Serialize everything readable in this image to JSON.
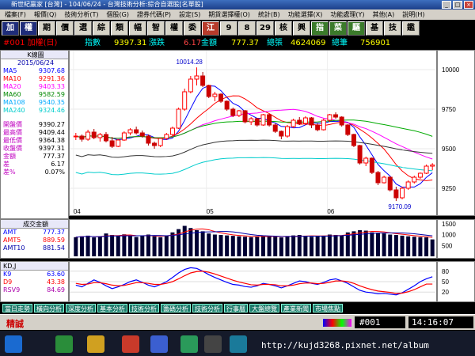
{
  "window": {
    "title": "新世紀贏家 [台灣] - 104/06/24 - 台灣技術分析:綜合自選股[名單股]",
    "controls": [
      "_",
      "□",
      "×"
    ]
  },
  "menu": [
    "檔案(F)",
    "報價(Q)",
    "技術分析(T)",
    "個股(G)",
    "證券代碼(P)",
    "設定(S)",
    "期貨選擇權(O)",
    "統計(B)",
    "功能選擇(X)",
    "功能處理(Y)",
    "其他(A)",
    "說明(H)"
  ],
  "toolbar": [
    "加",
    "權",
    "期",
    "價",
    "選",
    "綜",
    "類",
    "幅",
    "智",
    "權",
    "委",
    "江",
    "9",
    "8",
    "29",
    "核",
    "興",
    "指",
    "菜",
    "驅",
    "基",
    "技",
    "鑑"
  ],
  "infobar": {
    "code": "#001 加權(日)",
    "price_label": "指數",
    "price": "9397.31",
    "change_label": "漲跌",
    "change": "6.17",
    "amount_label": "金額",
    "amount": "777.37",
    "volume_label": "總張",
    "volume": "4624069",
    "lots_label": "總筆",
    "lots": "756901"
  },
  "left_panel": {
    "kline_header": "K線圖",
    "date": "2015/06/24",
    "rows": [
      {
        "label": "MA5",
        "value": "9307.68",
        "color": "#0000ff"
      },
      {
        "label": "MA10",
        "value": "9291.36",
        "color": "#ff0000"
      },
      {
        "label": "MA20",
        "value": "9403.33",
        "color": "#ff00ff"
      },
      {
        "label": "MA60",
        "value": "9582.59",
        "color": "#008800"
      },
      {
        "label": "MA108",
        "value": "9540.35",
        "color": "#00aaff"
      },
      {
        "label": "MA240",
        "value": "9324.46",
        "color": "#00cccc"
      }
    ],
    "ohlc": [
      {
        "label": "開盤價",
        "value": "9390.27"
      },
      {
        "label": "最高價",
        "value": "9409.44"
      },
      {
        "label": "最低價",
        "value": "9364.38"
      },
      {
        "label": "收盤價",
        "value": "9397.31"
      },
      {
        "label": "金額",
        "value": "777.37"
      },
      {
        "label": "差",
        "value": "6.17"
      },
      {
        "label": "差%",
        "value": "0.07%"
      }
    ],
    "vol_header": "成交金額",
    "vol_rows": [
      {
        "label": "AMT",
        "value": "777.37",
        "color": "#0000ff"
      },
      {
        "label": "AMT5",
        "value": "889.59",
        "color": "#ff0000"
      },
      {
        "label": "AMT10",
        "value": "881.54",
        "color": "#0000aa"
      }
    ],
    "kd_header": "KD,J",
    "kd_rows": [
      {
        "label": "K9",
        "value": "63.60",
        "color": "#0000ff"
      },
      {
        "label": "D9",
        "value": "43.38",
        "color": "#ff0000"
      },
      {
        "label": "RSV9",
        "value": "84.69",
        "color": "#aa00aa"
      }
    ]
  },
  "chart_data": [
    {
      "type": "candlestick",
      "x_tick_labels": [
        "04",
        "05",
        "06"
      ],
      "y_ticks": [
        "10000",
        "9750",
        "9500",
        "9250"
      ],
      "ylim": [
        9100,
        10100
      ],
      "annotations": [
        "10014.28",
        "9170.09"
      ],
      "candles": [
        [
          9575,
          9600,
          9555,
          9580
        ],
        [
          9580,
          9590,
          9545,
          9560
        ],
        [
          9560,
          9620,
          9550,
          9605
        ],
        [
          9605,
          9625,
          9560,
          9570
        ],
        [
          9570,
          9600,
          9545,
          9590
        ],
        [
          9590,
          9605,
          9540,
          9550
        ],
        [
          9550,
          9575,
          9505,
          9515
        ],
        [
          9515,
          9560,
          9510,
          9555
        ],
        [
          9555,
          9610,
          9550,
          9600
        ],
        [
          9600,
          9630,
          9585,
          9620
        ],
        [
          9620,
          9640,
          9590,
          9600
        ],
        [
          9600,
          9615,
          9570,
          9580
        ],
        [
          9580,
          9590,
          9520,
          9535
        ],
        [
          9535,
          9545,
          9500,
          9520
        ],
        [
          9520,
          9570,
          9510,
          9565
        ],
        [
          9565,
          9600,
          9555,
          9590
        ],
        [
          9590,
          9640,
          9580,
          9630
        ],
        [
          9630,
          9760,
          9625,
          9750
        ],
        [
          9750,
          9880,
          9740,
          9860
        ],
        [
          9860,
          9960,
          9850,
          9940
        ],
        [
          9940,
          10014,
          9900,
          9960
        ],
        [
          9960,
          9985,
          9890,
          9900
        ],
        [
          9900,
          9905,
          9820,
          9830
        ],
        [
          9830,
          9860,
          9800,
          9845
        ],
        [
          9845,
          9850,
          9790,
          9800
        ],
        [
          9800,
          9805,
          9740,
          9750
        ],
        [
          9750,
          9760,
          9700,
          9710
        ],
        [
          9710,
          9745,
          9700,
          9740
        ],
        [
          9740,
          9745,
          9660,
          9670
        ],
        [
          9670,
          9700,
          9650,
          9690
        ],
        [
          9690,
          9695,
          9640,
          9650
        ],
        [
          9650,
          9720,
          9645,
          9715
        ],
        [
          9715,
          9720,
          9640,
          9650
        ],
        [
          9650,
          9660,
          9600,
          9610
        ],
        [
          9610,
          9615,
          9560,
          9580
        ],
        [
          9580,
          9650,
          9570,
          9640
        ],
        [
          9640,
          9690,
          9630,
          9680
        ],
        [
          9680,
          9700,
          9650,
          9660
        ],
        [
          9660,
          9705,
          9650,
          9695
        ],
        [
          9695,
          9700,
          9630,
          9650
        ],
        [
          9650,
          9660,
          9610,
          9620
        ],
        [
          9620,
          9690,
          9615,
          9680
        ],
        [
          9680,
          9720,
          9670,
          9715
        ],
        [
          9715,
          9730,
          9690,
          9700
        ],
        [
          9700,
          9705,
          9640,
          9650
        ],
        [
          9650,
          9655,
          9580,
          9590
        ],
        [
          9590,
          9595,
          9510,
          9520
        ],
        [
          9520,
          9525,
          9400,
          9410
        ],
        [
          9410,
          9450,
          9390,
          9440
        ],
        [
          9440,
          9445,
          9340,
          9350
        ],
        [
          9350,
          9360,
          9270,
          9285
        ],
        [
          9285,
          9330,
          9280,
          9320
        ],
        [
          9320,
          9325,
          9230,
          9240
        ],
        [
          9240,
          9260,
          9170,
          9190
        ],
        [
          9190,
          9260,
          9180,
          9250
        ],
        [
          9250,
          9300,
          9240,
          9290
        ],
        [
          9290,
          9330,
          9280,
          9320
        ],
        [
          9320,
          9350,
          9310,
          9345
        ],
        [
          9345,
          9400,
          9340,
          9390
        ],
        [
          9390,
          9409,
          9364,
          9397
        ]
      ]
    },
    {
      "type": "bar",
      "name": "成交金額",
      "y_ticks": [
        "1500",
        "1000",
        "500"
      ],
      "ylim": [
        0,
        1600
      ],
      "values": [
        880,
        920,
        950,
        870,
        900,
        1050,
        980,
        940,
        1010,
        930,
        890,
        950,
        1000,
        920,
        880,
        960,
        1100,
        1250,
        1400,
        1300,
        1200,
        1150,
        1050,
        1000,
        980,
        960,
        940,
        920,
        900,
        880,
        910,
        950,
        930,
        900,
        870,
        920,
        960,
        980,
        940,
        900,
        910,
        950,
        1000,
        980,
        950,
        1100,
        1150,
        1200,
        1180,
        1100,
        1080,
        1050,
        1000,
        980,
        950,
        920,
        900,
        880,
        870,
        777
      ]
    },
    {
      "type": "line",
      "name": "KD",
      "y_ticks": [
        "80",
        "50",
        "20"
      ],
      "ylim": [
        0,
        100
      ],
      "series": [
        {
          "name": "K9",
          "color": "#0000ff",
          "values": [
            40,
            35,
            45,
            55,
            48,
            38,
            30,
            35,
            42,
            50,
            55,
            48,
            40,
            35,
            42,
            50,
            62,
            75,
            85,
            90,
            88,
            80,
            70,
            62,
            55,
            48,
            42,
            40,
            36,
            34,
            38,
            45,
            42,
            38,
            32,
            38,
            45,
            52,
            50,
            45,
            42,
            48,
            55,
            58,
            52,
            45,
            35,
            25,
            20,
            18,
            15,
            16,
            14,
            12,
            18,
            28,
            38,
            50,
            58,
            64
          ]
        },
        {
          "name": "D9",
          "color": "#ff0000",
          "values": [
            45,
            42,
            43,
            47,
            47,
            44,
            40,
            38,
            39,
            43,
            47,
            47,
            45,
            42,
            42,
            45,
            50,
            58,
            67,
            75,
            79,
            80,
            77,
            72,
            66,
            60,
            54,
            49,
            45,
            41,
            40,
            42,
            42,
            41,
            38,
            38,
            40,
            44,
            46,
            46,
            44,
            45,
            48,
            52,
            52,
            50,
            45,
            38,
            32,
            27,
            23,
            21,
            19,
            16,
            17,
            21,
            27,
            35,
            43,
            43
          ]
        }
      ]
    }
  ],
  "bottom_tabs": [
    "當日走勢",
    "橫向分析",
    "深度分析",
    "基本分析",
    "技術分析",
    "籌碼分析",
    "技術分析",
    "行事曆",
    "大盤總覽",
    "產業新聞",
    "市場焦點"
  ],
  "status": {
    "left": "精誠",
    "code": "#001",
    "time": "14:16:07"
  },
  "taskbar": {
    "url": "http://kujd3268.pixnet.net/album"
  }
}
